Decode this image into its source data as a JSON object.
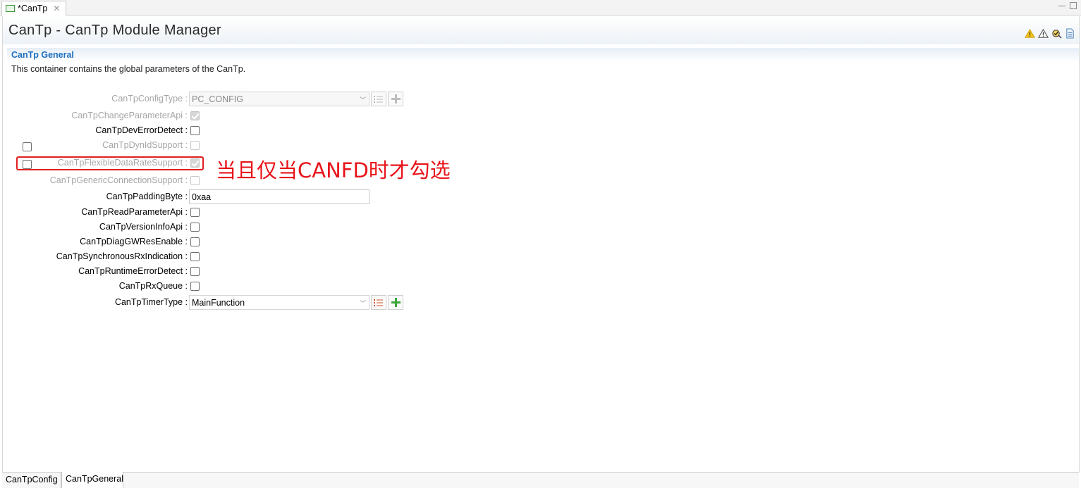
{
  "editor_tab": {
    "title": "*CanTp",
    "close_glyph": "✕"
  },
  "header": {
    "title": "CanTp - CanTp Module Manager",
    "icons": [
      "warning-icon",
      "warning-outline-icon",
      "validate-icon",
      "document-icon"
    ]
  },
  "section": {
    "title": "CanTp General",
    "description": "This container contains the global parameters of the CanTp."
  },
  "params": {
    "config_type": {
      "label": "CanTpConfigType :",
      "value": "PC_CONFIG"
    },
    "change_param_api": {
      "label": "CanTpChangeParameterApi :"
    },
    "dev_error_detect": {
      "label": "CanTpDevErrorDetect :"
    },
    "dyn_id_support": {
      "label": "CanTpDynIdSupport :"
    },
    "flexible_data_rate": {
      "label": "CanTpFlexibleDataRateSupport :"
    },
    "generic_connection": {
      "label": "CanTpGenericConnectionSupport :"
    },
    "padding_byte": {
      "label": "CanTpPaddingByte :",
      "value": "0xaa"
    },
    "read_param_api": {
      "label": "CanTpReadParameterApi :"
    },
    "version_info_api": {
      "label": "CanTpVersionInfoApi :"
    },
    "diag_gw_res": {
      "label": "CanTpDiagGWResEnable :"
    },
    "sync_rx_ind": {
      "label": "CanTpSynchronousRxIndication :"
    },
    "runtime_error": {
      "label": "CanTpRuntimeErrorDetect :"
    },
    "rx_queue": {
      "label": "CanTpRxQueue :"
    },
    "timer_type": {
      "label": "CanTpTimerType :",
      "value": "MainFunction"
    }
  },
  "annotation": {
    "text": "当且仅当CANFD时才勾选",
    "color": "#e8141b"
  },
  "bottom_tabs": [
    "CanTpConfig",
    "CanTpGeneral"
  ]
}
